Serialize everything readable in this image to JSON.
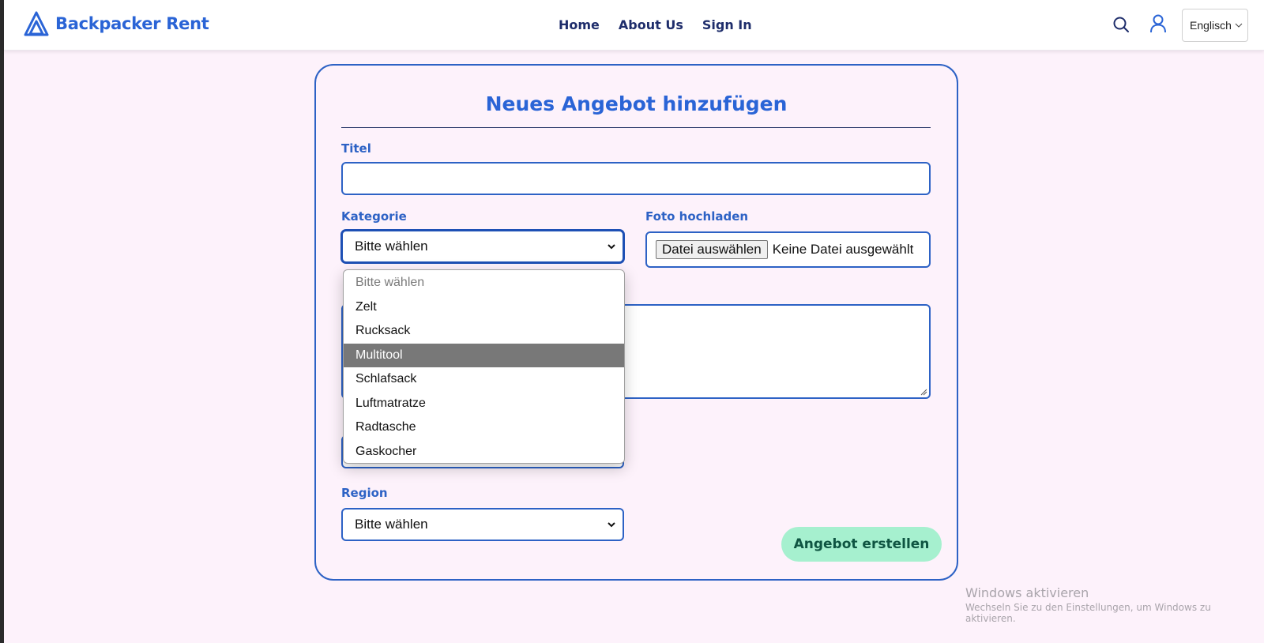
{
  "header": {
    "brand": "Backpacker Rent",
    "nav": [
      "Home",
      "About Us",
      "Sign In"
    ],
    "language": "Englisch"
  },
  "form": {
    "title": "Neues Angebot hinzufügen",
    "title_label": "Titel",
    "title_value": "",
    "category_label": "Kategorie",
    "category_value": "Bitte wählen",
    "photo_label": "Foto hochladen",
    "file_button": "Datei auswählen",
    "file_status": "Keine Datei ausgewählt",
    "region_label": "Region",
    "region_value": "Bitte wählen",
    "submit_label": "Angebot erstellen"
  },
  "dropdown": {
    "options": [
      "Bitte wählen",
      "Zelt",
      "Rucksack",
      "Multitool",
      "Schlafsack",
      "Luftmatratze",
      "Radtasche",
      "Gaskocher"
    ],
    "highlighted": "Multitool"
  },
  "watermark": {
    "line1": "Windows aktivieren",
    "line2": "Wechseln Sie zu den Einstellungen, um Windows zu aktivieren."
  },
  "colors": {
    "accent": "#2d62c5",
    "page_bg": "#fdf2fb",
    "submit_bg": "#a6f0cf",
    "submit_text": "#0f5542",
    "highlight": "#787878"
  },
  "icons": [
    "logo-triangle-icon",
    "search-icon",
    "user-icon",
    "chevron-down-icon",
    "resize-grip-icon"
  ]
}
